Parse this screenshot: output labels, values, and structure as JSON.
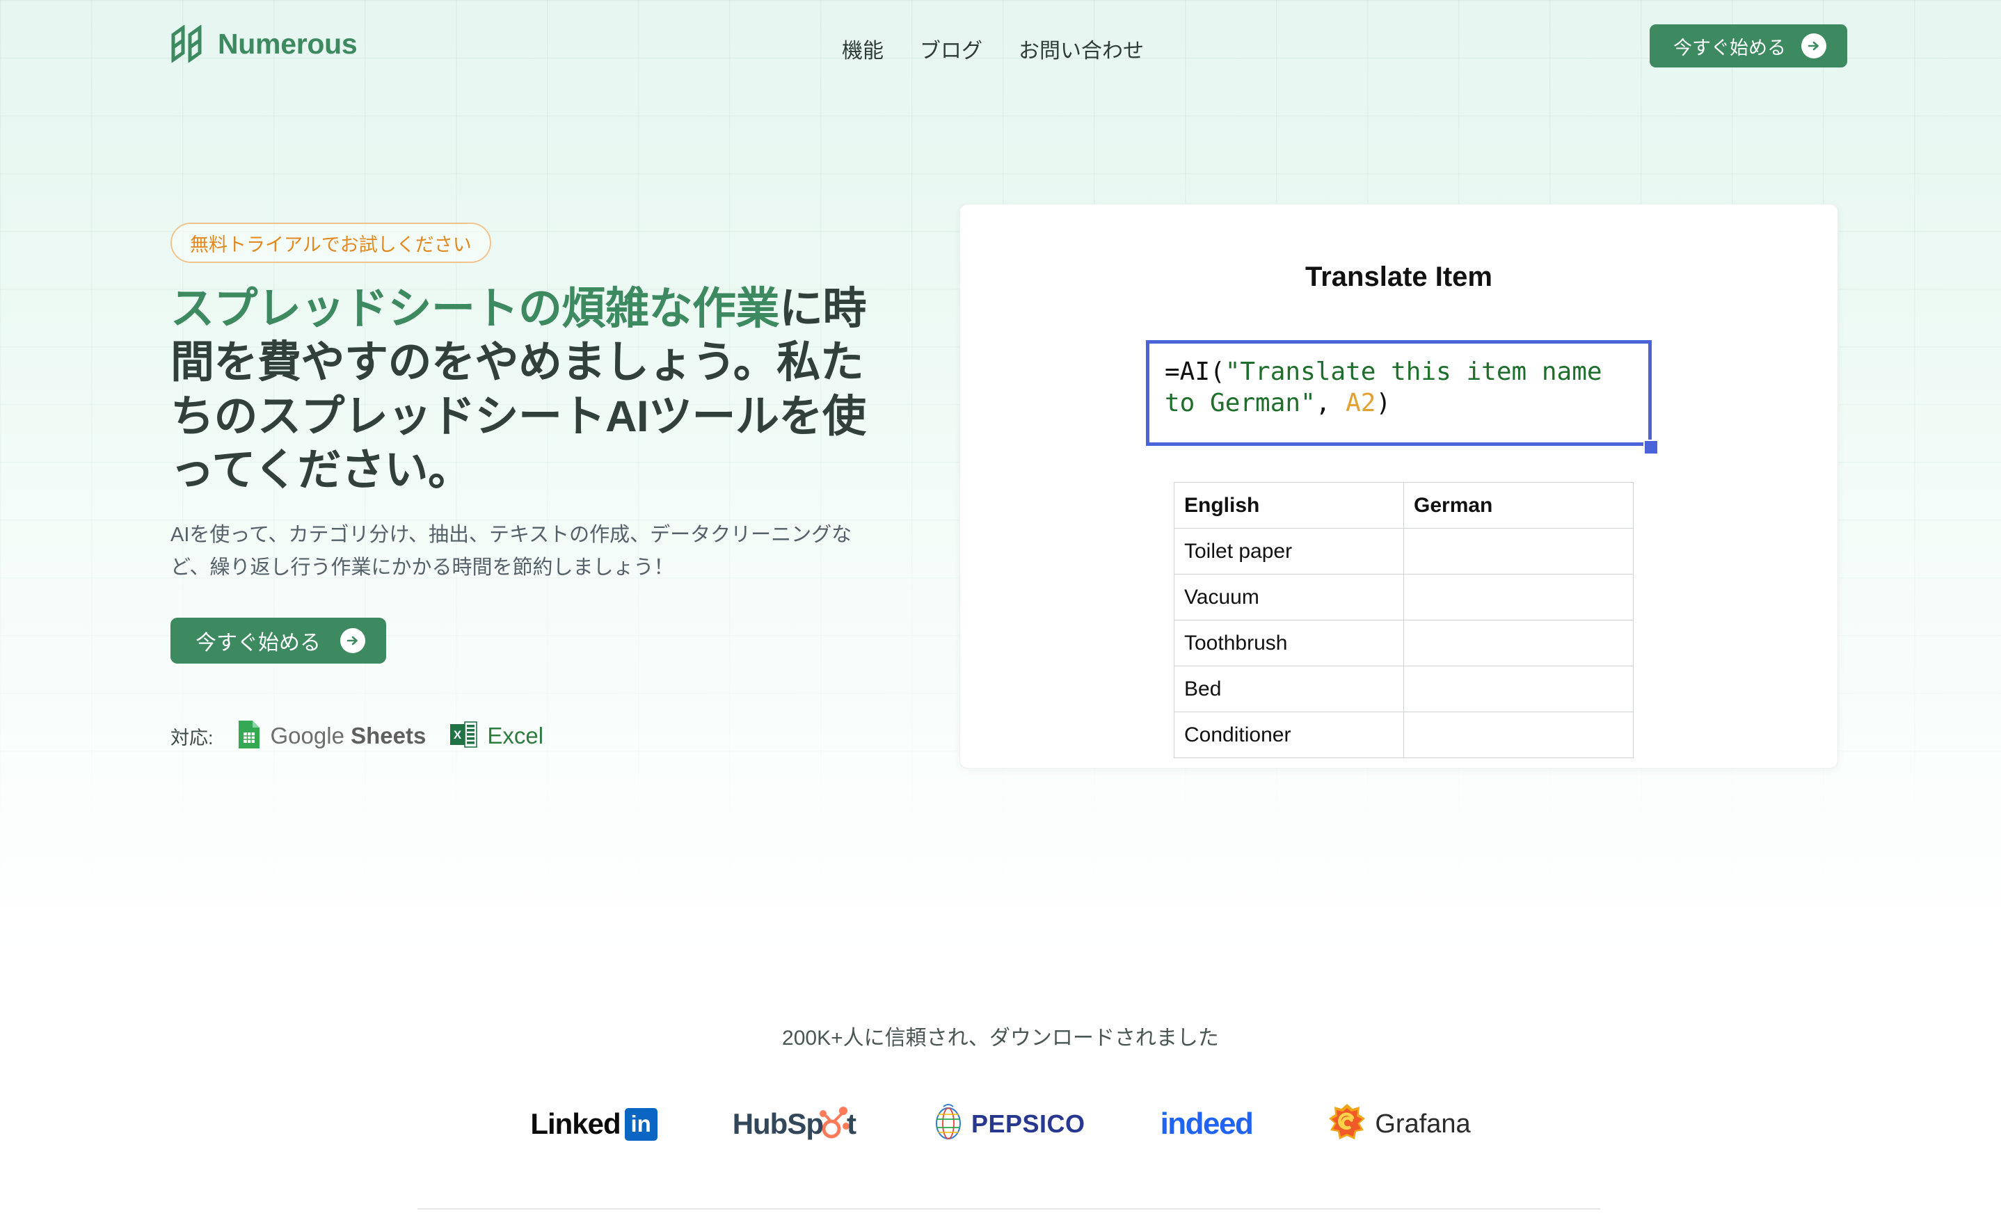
{
  "brand": {
    "name": "Numerous",
    "accent_green": "#3d8a60",
    "accent_orange": "#e2891f",
    "cell_blue": "#4a63d8"
  },
  "header": {
    "nav": [
      {
        "label": "機能",
        "name": "nav-features"
      },
      {
        "label": "ブログ",
        "name": "nav-blog"
      },
      {
        "label": "お問い合わせ",
        "name": "nav-contact"
      }
    ],
    "cta_label": "今すぐ始める"
  },
  "hero": {
    "badge": "無料トライアルでお試しください",
    "headline_green": "スプレッドシートの煩雑な作業",
    "headline_rest": "に時間を費やすのをやめましょう。私たちのスプレッドシートAIツールを使ってください。",
    "subtext": "AIを使って、カテゴリ分け、抽出、テキストの作成、データクリーニングなど、繰り返し行う作業にかかる時間を節約しましょう！",
    "cta_label": "今すぐ始める",
    "compat_label": "対応:",
    "compat": [
      {
        "name": "google-sheets",
        "label_light": "Google",
        "label_bold": "Sheets"
      },
      {
        "name": "excel",
        "label": "Excel"
      }
    ]
  },
  "demo": {
    "title": "Translate Item",
    "formula": {
      "prefix": "=AI(",
      "string": "\"Translate this item name to German\"",
      "separator": ", ",
      "reference": "A2",
      "suffix": ")"
    },
    "table": {
      "headers": [
        "English",
        "German"
      ],
      "rows": [
        [
          "Toilet paper",
          ""
        ],
        [
          "Vacuum",
          ""
        ],
        [
          "Toothbrush",
          ""
        ],
        [
          "Bed",
          ""
        ],
        [
          "Conditioner",
          ""
        ]
      ]
    }
  },
  "trust": {
    "text": "200K+人に信頼され、ダウンロードされました",
    "logos": [
      {
        "name": "linkedin",
        "text": "Linked",
        "badge": "in"
      },
      {
        "name": "hubspot",
        "text": "HubSp",
        "text2": "t"
      },
      {
        "name": "pepsico",
        "text": "PEPSICO"
      },
      {
        "name": "indeed",
        "text": "indeed"
      },
      {
        "name": "grafana",
        "text": "Grafana"
      }
    ]
  }
}
